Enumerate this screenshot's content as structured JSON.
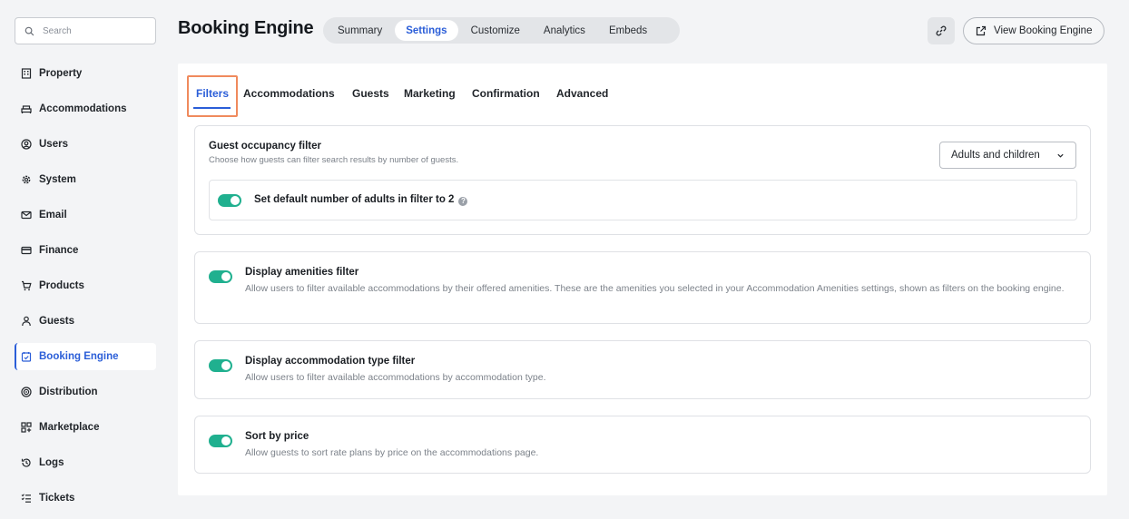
{
  "search": {
    "placeholder": "Search"
  },
  "sidebar": {
    "items": [
      {
        "label": "Property",
        "icon": "building-icon"
      },
      {
        "label": "Accommodations",
        "icon": "bed-icon"
      },
      {
        "label": "Users",
        "icon": "user-circle-icon"
      },
      {
        "label": "System",
        "icon": "gear-icon"
      },
      {
        "label": "Email",
        "icon": "envelope-icon"
      },
      {
        "label": "Finance",
        "icon": "credit-card-icon"
      },
      {
        "label": "Products",
        "icon": "cart-icon"
      },
      {
        "label": "Guests",
        "icon": "person-icon"
      },
      {
        "label": "Booking Engine",
        "icon": "calendar-check-icon",
        "active": true
      },
      {
        "label": "Distribution",
        "icon": "radar-icon"
      },
      {
        "label": "Marketplace",
        "icon": "grid-plus-icon"
      },
      {
        "label": "Logs",
        "icon": "history-icon"
      },
      {
        "label": "Tickets",
        "icon": "checklist-icon"
      }
    ]
  },
  "header": {
    "title": "Booking Engine",
    "tabs": [
      "Summary",
      "Settings",
      "Customize",
      "Analytics",
      "Embeds"
    ],
    "active_tab": "Settings",
    "view_button": "View Booking Engine"
  },
  "subtabs": {
    "items": [
      "Filters",
      "Accommodations",
      "Guests",
      "Marketing",
      "Confirmation",
      "Advanced"
    ],
    "active": "Filters"
  },
  "occupancy": {
    "title": "Guest occupancy filter",
    "desc": "Choose how guests can filter search results by number of guests.",
    "dropdown_value": "Adults and children",
    "default_adults_label": "Set default number of adults in filter to 2",
    "default_adults_on": true
  },
  "settings": [
    {
      "title": "Display amenities filter",
      "desc": "Allow users to filter available accommodations by their offered amenities. These are the amenities you selected in your Accommodation Amenities settings, shown as filters on the booking engine.",
      "on": true
    },
    {
      "title": "Display accommodation type filter",
      "desc": "Allow users to filter available accommodations by accommodation type.",
      "on": true
    },
    {
      "title": "Sort by price",
      "desc": "Allow guests to sort rate plans by price on the accommodations page.",
      "on": true
    }
  ],
  "colors": {
    "accent": "#2b5ed8",
    "toggle_on": "#20b08f",
    "highlight": "#f08a5d"
  }
}
